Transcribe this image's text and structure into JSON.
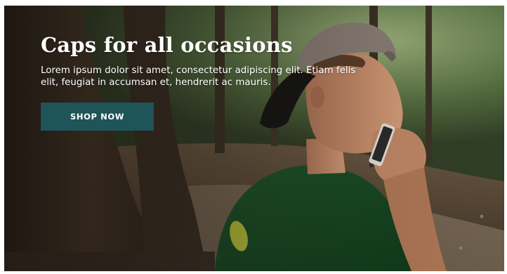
{
  "hero": {
    "title": "Caps for all occasions",
    "text": "Lorem ipsum dolor sit amet, consectetur adipiscing elit. Etiam felis elit, feugiat in accumsan et, hendrerit ac mauris.",
    "button_label": "SHOP NOW",
    "button_color": "#1f5458"
  }
}
